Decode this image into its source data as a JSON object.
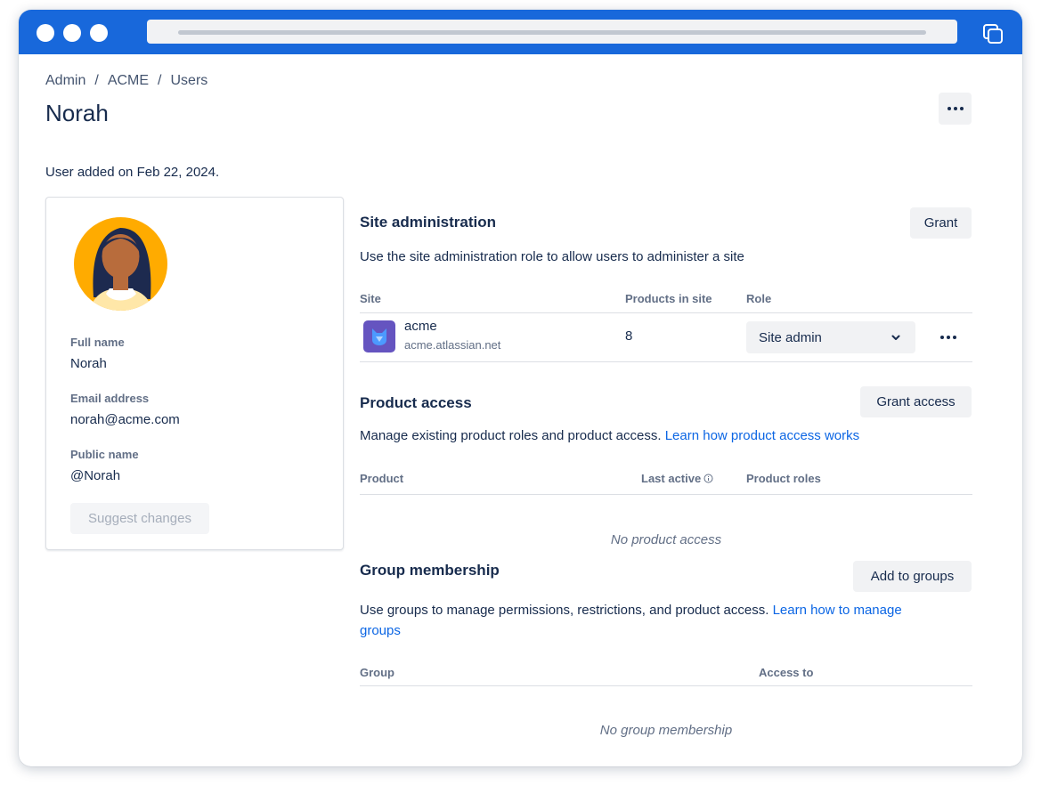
{
  "window": {
    "controls": [
      "close-dot",
      "minimize-dot",
      "maximize-dot"
    ],
    "accent_color": "#1868DB"
  },
  "breadcrumb": {
    "items": [
      "Admin",
      "ACME",
      "Users"
    ],
    "separator": "/"
  },
  "page": {
    "title": "Norah",
    "more_icon": "more-horizontal-icon",
    "added_text": "User added on Feb 22, 2024."
  },
  "profile": {
    "full_name_label": "Full name",
    "full_name": "Norah",
    "email_label": "Email address",
    "email": "norah@acme.com",
    "public_name_label": "Public name",
    "public_name": "@Norah",
    "suggest_label": "Suggest changes"
  },
  "site_admin": {
    "title": "Site administration",
    "grant_label": "Grant",
    "description": "Use the site administration role to allow users to administer a site",
    "columns": {
      "site": "Site",
      "products": "Products in site",
      "role": "Role"
    },
    "row": {
      "name": "acme",
      "url": "acme.atlassian.net",
      "products": "8",
      "role": "Site admin"
    }
  },
  "product_access": {
    "title": "Product access",
    "grant_label": "Grant access",
    "description": "Manage existing product roles and product access.",
    "link": "Learn how product access works",
    "columns": {
      "product": "Product",
      "last_active": "Last active",
      "roles": "Product roles"
    },
    "empty": "No product access"
  },
  "groups": {
    "title": "Group membership",
    "add_label": "Add to groups",
    "description": "Use groups to manage permissions, restrictions, and product access.",
    "link_line1": "Learn how to manage",
    "link_line2": "groups",
    "columns": {
      "group": "Group",
      "access": "Access to"
    },
    "empty": "No group membership"
  }
}
